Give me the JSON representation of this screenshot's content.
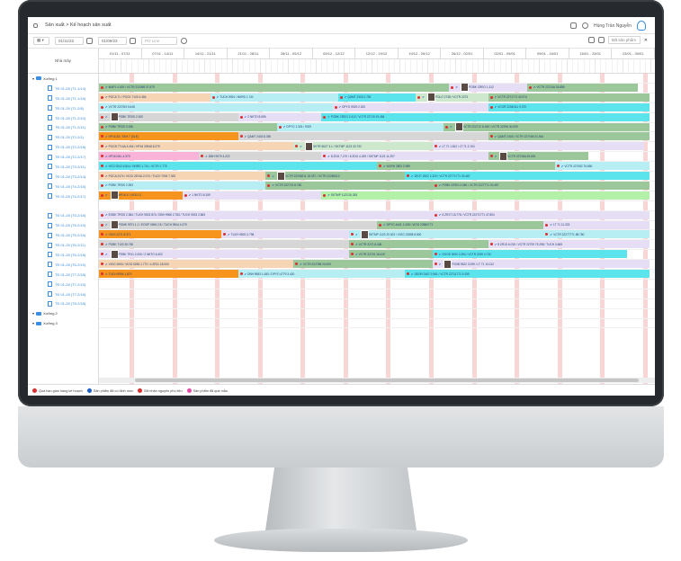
{
  "breadcrumb": "Sản xuất > Kế hoạch sản xuất",
  "header_user": "Hùng Trần Nguyễn",
  "toolbar": {
    "date_from": "01/11/22",
    "date_to": "01/09/23",
    "order_placeholder": "PO Line",
    "product_search": "Mã sản phẩm"
  },
  "left_header": "Nhà máy",
  "weeks": [
    "01/11 - 07/11",
    "07/11 - 14/11",
    "14/11 - 21/11",
    "21/11 - 28/11",
    "28/11 - 05/12",
    "05/12 - 12/12",
    "12/12 - 19/12",
    "19/12 - 26/12",
    "26/12 - 02/01",
    "02/01 - 09/01",
    "09/01 - 16/01",
    "16/01 - 23/01",
    "23/01 - 30/01"
  ],
  "rows": [
    {
      "kind": "group",
      "label": "Xưởng 1"
    },
    {
      "kind": "order",
      "label": "TĐ 01-28 (T1-1/14)"
    },
    {
      "kind": "order",
      "label": "TĐ 01-28 (T1-1/16)"
    },
    {
      "kind": "order",
      "label": "TĐ 01-28 (T1-2/6)"
    },
    {
      "kind": "order",
      "label": "TĐ 01-28 (T1-2/10)"
    },
    {
      "kind": "order",
      "label": "TĐ 01-28 (T1-2/11)"
    },
    {
      "kind": "order",
      "label": "TĐ 01-28 (T2-2/1)"
    },
    {
      "kind": "order",
      "label": "TĐ 01-28 (T2-2/18)"
    },
    {
      "kind": "order",
      "label": "TĐ 01-28 (T2-2/17)"
    },
    {
      "kind": "order",
      "label": "TĐ 01-28 (T3-2/11)"
    },
    {
      "kind": "order",
      "label": "TĐ 01-28 (T3-2/14)"
    },
    {
      "kind": "order",
      "label": "TĐ 01-28 (T4-2/15)"
    },
    {
      "kind": "order",
      "label": "TĐ 01-28 (T4-2/17)"
    },
    {
      "kind": "order",
      "label": ""
    },
    {
      "kind": "order",
      "label": "TĐ 01-28 (T5-2/18)"
    },
    {
      "kind": "order",
      "label": "TĐ 01-28 (T5-2/15)"
    },
    {
      "kind": "order",
      "label": "TĐ 01-28 (T5-2/16)"
    },
    {
      "kind": "order",
      "label": "TĐ 01-28 (T6-2/11)"
    },
    {
      "kind": "order",
      "label": "TĐ 01-28 (T6-2/18)"
    },
    {
      "kind": "order",
      "label": "TĐ 01-28 (T6-2/19)"
    },
    {
      "kind": "order",
      "label": "TĐ 01-28 (T7-2/18)"
    },
    {
      "kind": "order",
      "label": "TĐ 01-28 (T7-2/15)"
    },
    {
      "kind": "order",
      "label": "TĐ 01-28 (T7-2/16)"
    },
    {
      "kind": "order",
      "label": "TĐ 01-28 (T8-2/18)"
    },
    {
      "kind": "group",
      "label": "Xưởng 2"
    },
    {
      "kind": "group",
      "label": "Xưởng 3"
    }
  ],
  "bars": [
    {
      "row": 1,
      "start": 0.0,
      "end": 0.63,
      "color": "#9bc79b",
      "text": "MAP1 4.000 / VCTR 222098 37.579"
    },
    {
      "row": 1,
      "start": 0.63,
      "end": 0.77,
      "color": "#e6def5",
      "text": "POBK CREO 1.312"
    },
    {
      "row": 1,
      "start": 0.77,
      "end": 0.97,
      "color": "#9bc79b",
      "text": "VCTR 22724A 35.889"
    },
    {
      "row": 2,
      "start": 0.0,
      "end": 0.2,
      "color": "#f6d5b5",
      "text": "POCA 71 / POCK 7100 4.384"
    },
    {
      "row": 2,
      "start": 0.2,
      "end": 0.43,
      "color": "#b7eef4",
      "text": "TUCH 9094 / NHRD 1.741"
    },
    {
      "row": 2,
      "start": 0.43,
      "end": 0.57,
      "color": "#5ce4ec",
      "text": "QAMT 2403 2.782"
    },
    {
      "row": 2,
      "start": 0.57,
      "end": 0.7,
      "color": "#cde8cd",
      "text": "POLO 2738 / VCTR 2273"
    },
    {
      "row": 2,
      "start": 0.7,
      "end": 0.99,
      "color": "#9bc79b",
      "text": "VCTR 2271771 40.974"
    },
    {
      "row": 3,
      "start": 0.0,
      "end": 0.42,
      "color": "#b7eef4",
      "text": "VCTR 222783 9.648"
    },
    {
      "row": 3,
      "start": 0.42,
      "end": 0.7,
      "color": "#e6def5",
      "text": "DPYO 9029 2.320"
    },
    {
      "row": 3,
      "start": 0.7,
      "end": 0.99,
      "color": "#5ce4ec",
      "text": "VCOR 2206/111 9.370"
    },
    {
      "row": 4,
      "start": 0.0,
      "end": 0.25,
      "color": "#d6d6d6",
      "text": "POBK TRDS 2.000"
    },
    {
      "row": 4,
      "start": 0.25,
      "end": 0.4,
      "color": "#e6def5",
      "text": "2 NKTO 8.696"
    },
    {
      "row": 4,
      "start": 0.4,
      "end": 0.99,
      "color": "#5ce4ec",
      "text": "POBK CREO 2.412 / VCTR 22719 19.484"
    },
    {
      "row": 5,
      "start": 0.0,
      "end": 0.32,
      "color": "#9bc79b",
      "text": "POBK TRDS 3.336"
    },
    {
      "row": 5,
      "start": 0.32,
      "end": 0.62,
      "color": "#b7eef4",
      "text": "DPYO 1.324 / 9029"
    },
    {
      "row": 5,
      "start": 0.62,
      "end": 0.99,
      "color": "#9bc79b",
      "text": "VCTR 222712 8.349 / VCTR 22296 30.009"
    },
    {
      "row": 6,
      "start": 0.0,
      "end": 0.25,
      "color": "#f7941d",
      "text": "HP16 38 / SKH 7 (SLE)"
    },
    {
      "row": 6,
      "start": 0.25,
      "end": 0.7,
      "color": "#d6d6d6",
      "text": "QAMT 2403 8.390"
    },
    {
      "row": 6,
      "start": 0.7,
      "end": 0.99,
      "color": "#9bc79b",
      "text": "QAMT 2403 / VCTR 22749A 31.944"
    },
    {
      "row": 7,
      "start": 0.0,
      "end": 0.35,
      "color": "#f6d5b5",
      "text": "POCB 7714A 3.454 / HP16 20948 8.379"
    },
    {
      "row": 7,
      "start": 0.35,
      "end": 0.6,
      "color": "#cde8cd",
      "text": "SKTR 5627 3.1 / SKTMP 1123 20.732"
    },
    {
      "row": 7,
      "start": 0.6,
      "end": 0.98,
      "color": "#e6def5",
      "text": "LT 71 1.812 / LT 71 2.193"
    },
    {
      "row": 8,
      "start": 0.0,
      "end": 0.18,
      "color": "#f9b3d8",
      "text": "HP16 NKL 4.379"
    },
    {
      "row": 8,
      "start": 0.18,
      "end": 0.4,
      "color": "#d6d6d6",
      "text": "DBH 9979 4.222"
    },
    {
      "row": 8,
      "start": 0.4,
      "end": 0.7,
      "color": "#e6def5",
      "text": "8 ZDG 7.270 / 8 ZDO 4.329 / SKTMP 1123 11.297"
    },
    {
      "row": 8,
      "start": 0.7,
      "end": 0.88,
      "color": "#9bc79b",
      "text": "VCTR 22728A 25.600"
    },
    {
      "row": 9,
      "start": 0.0,
      "end": 0.5,
      "color": "#5ce4ec",
      "text": "HCO 9242 6.804 / NHRD 1.741 / VCTR 1.775"
    },
    {
      "row": 9,
      "start": 0.5,
      "end": 0.82,
      "color": "#9bc79b",
      "text": "NGRH 2803 2.989"
    },
    {
      "row": 9,
      "start": 0.82,
      "end": 0.99,
      "color": "#b7eef4",
      "text": "VCTR 227082 76.850"
    },
    {
      "row": 10,
      "start": 0.0,
      "end": 0.3,
      "color": "#f6d5b5",
      "text": "POCA 2474 / VIOG 2874A 2.074 / TUCH 7094 7.352"
    },
    {
      "row": 10,
      "start": 0.3,
      "end": 0.55,
      "color": "#9bc79b",
      "text": "VCTR 22298211 18.337 / VCTR 22269312"
    },
    {
      "row": 10,
      "start": 0.55,
      "end": 0.99,
      "color": "#5ce4ec",
      "text": "2EOT 2602 2.320 / VCTR 22771771 30.487"
    },
    {
      "row": 11,
      "start": 0.0,
      "end": 0.3,
      "color": "#b7eef4",
      "text": "POBK TRDS 2.953"
    },
    {
      "row": 11,
      "start": 0.3,
      "end": 0.6,
      "color": "#9bc79b",
      "text": "VCTR 222701 8.750"
    },
    {
      "row": 11,
      "start": 0.6,
      "end": 0.99,
      "color": "#9bc79b",
      "text": "POBK CREO 2.060 / VCTR 2227771 30.457"
    },
    {
      "row": 12,
      "start": 0.0,
      "end": 0.15,
      "color": "#f7941d",
      "text": "HP16 3 / VIOG 11"
    },
    {
      "row": 12,
      "start": 0.15,
      "end": 0.4,
      "color": "#e6def5",
      "text": "1 NKTO 8.159"
    },
    {
      "row": 12,
      "start": 0.4,
      "end": 0.99,
      "color": "#b3f0a8",
      "text": "SKTMP 1123 26.283"
    },
    {
      "row": 14,
      "start": 0.0,
      "end": 0.6,
      "color": "#e6def5",
      "text": "EOBK TRDS 2.384 / TUCH 9523 874 / DBH 9966 2.783 / TUCH 9023 2.863"
    },
    {
      "row": 14,
      "start": 0.6,
      "end": 0.99,
      "color": "#e6def5",
      "text": "6 ZR1T 18.776 / VCTR 22271771 47.804"
    },
    {
      "row": 15,
      "start": 0.0,
      "end": 0.5,
      "color": "#d6d6d6",
      "text": "POMK 9971 1.1 / EOGP 0694 2.8 / TUCH 9814 4.379"
    },
    {
      "row": 15,
      "start": 0.5,
      "end": 0.8,
      "color": "#9bc79b",
      "text": "DPYO 4441 2.408 / VIOG 22860771"
    },
    {
      "row": 15,
      "start": 0.8,
      "end": 0.99,
      "color": "#e6def5",
      "text": "LT 71 11.323"
    },
    {
      "row": 16,
      "start": 0.0,
      "end": 0.22,
      "color": "#f7941d",
      "text": "VIOG 2271 8.371"
    },
    {
      "row": 16,
      "start": 0.22,
      "end": 0.45,
      "color": "#e6def5",
      "text": "TUCH 9820 2.798"
    },
    {
      "row": 16,
      "start": 0.45,
      "end": 0.8,
      "color": "#b7eef4",
      "text": "SKTMP 1123 20.003 / VIOG 22808 8.800"
    },
    {
      "row": 16,
      "start": 0.8,
      "end": 0.99,
      "color": "#b7eef4",
      "text": "VCTR 22277771 58.780"
    },
    {
      "row": 17,
      "start": 0.0,
      "end": 0.45,
      "color": "#d6d6d6",
      "text": "POBK 7120 26.760"
    },
    {
      "row": 17,
      "start": 0.45,
      "end": 0.7,
      "color": "#9bc79b",
      "text": "VCTR 2271 8.406"
    },
    {
      "row": 17,
      "start": 0.7,
      "end": 0.99,
      "color": "#e6def5",
      "text": "8 ZR1S 6.015 / VCTR 22709 79.298 / TUCH 0.665"
    },
    {
      "row": 18,
      "start": 0.0,
      "end": 0.45,
      "color": "#e6def5",
      "text": "POBK TR11 2.000 / 2 NKTO 6.402"
    },
    {
      "row": 18,
      "start": 0.45,
      "end": 0.6,
      "color": "#9bc79b",
      "text": "VCTR 22719 16.419"
    },
    {
      "row": 18,
      "start": 0.6,
      "end": 0.95,
      "color": "#5ce4ec",
      "text": "DOOE 0000 2.394 / VCTR 2299 4.732"
    },
    {
      "row": 19,
      "start": 0.0,
      "end": 0.35,
      "color": "#f6d5b5",
      "text": "VIOG 2694 / VIOG 5255 1.773 / 4 ZR11 18.000"
    },
    {
      "row": 19,
      "start": 0.35,
      "end": 0.6,
      "color": "#9bc79b",
      "text": "VCTR 222788 20.009"
    },
    {
      "row": 19,
      "start": 0.6,
      "end": 0.99,
      "color": "#e6def5",
      "text": "PO0B 9522 3.099 / LT 71 10.012"
    },
    {
      "row": 20,
      "start": 0.0,
      "end": 0.25,
      "color": "#f7941d",
      "text": "TUCH 9994 1.870"
    },
    {
      "row": 20,
      "start": 0.25,
      "end": 0.55,
      "color": "#b7eef4",
      "text": "DBH 9983 1.480 / DPYO 4779 3.420"
    },
    {
      "row": 20,
      "start": 0.55,
      "end": 0.99,
      "color": "#5ce4ec",
      "text": "DEOR 2467 2.961 / VCTR 22711771 9.299"
    }
  ],
  "legend": [
    {
      "color": "#d93030",
      "text": "Quá hạn giao hàng kế hoạch"
    },
    {
      "color": "#1d5fc9",
      "text": "Sản phẩm đã có định mức"
    },
    {
      "color": "#d93030",
      "text": "Đã nhận nguyên phụ liệu"
    },
    {
      "color": "#e64aa8",
      "text": "Sản phẩm đã quá mẫu"
    }
  ]
}
